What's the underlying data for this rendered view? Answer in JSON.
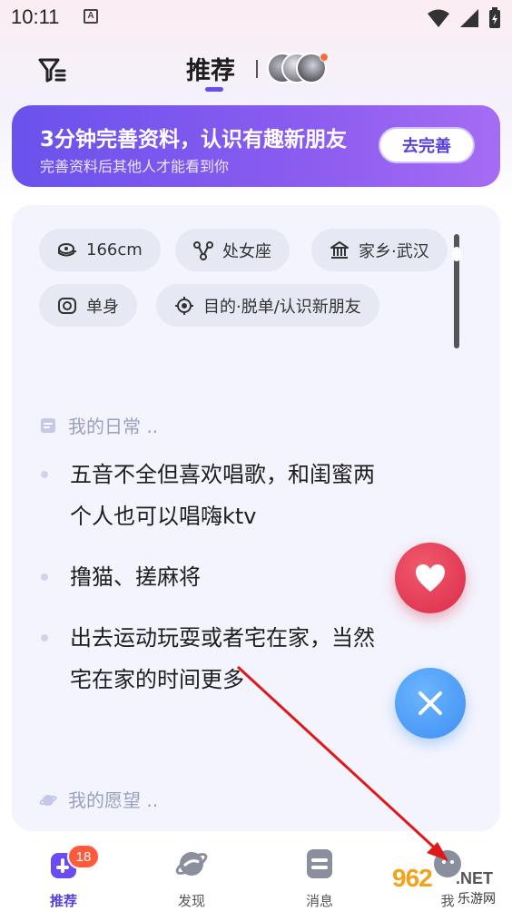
{
  "status_bar": {
    "time": "10:11",
    "notification_letter": "A"
  },
  "header": {
    "title": "推荐"
  },
  "banner": {
    "title": "3分钟完善资料，认识有趣新朋友",
    "subtitle": "完善资料后其他人才能看到你",
    "button": "去完善"
  },
  "tags": {
    "height": "166cm",
    "zodiac": "处女座",
    "hometown": "家乡·武汉",
    "status": "单身",
    "purpose": "目的·脱单/认识新朋友"
  },
  "daily": {
    "title": "我的日常 ..",
    "items": [
      "五音不全但喜欢唱歌，和闺蜜两",
      "个人也可以唱嗨ktv",
      "撸猫、搓麻将",
      "出去运动玩耍或者宅在家，当然",
      "宅在家的时间更多"
    ]
  },
  "wish": {
    "title": "我的愿望 .."
  },
  "nav": {
    "items": [
      {
        "label": "推荐",
        "badge": "18"
      },
      {
        "label": "发现"
      },
      {
        "label": "消息"
      },
      {
        "label": "我"
      }
    ]
  },
  "watermark": {
    "number": "962",
    "net": ".NET",
    "cn": "乐游网"
  },
  "colors": {
    "accent": "#6b4cf0",
    "like": "#dc2b49",
    "skip": "#3d8ef2",
    "badge": "#ff5a3c"
  }
}
